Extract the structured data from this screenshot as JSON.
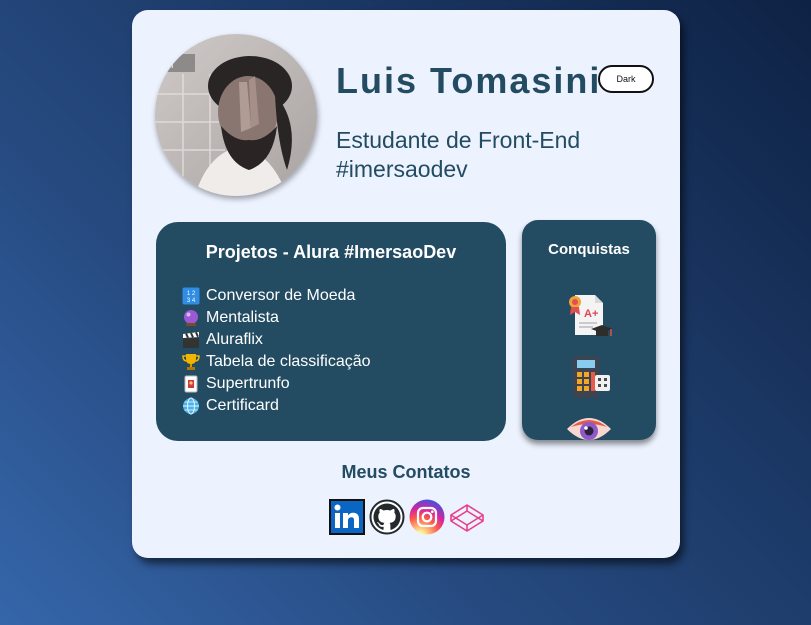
{
  "profile": {
    "name": "Luis Tomasini",
    "subtitle_line1": "Estudante de Front-End",
    "subtitle_line2": "#imersaodev",
    "photo_alt": "Foto de perfil"
  },
  "theme_toggle": {
    "label": "Dark"
  },
  "projects": {
    "title": "Projetos - Alura #ImersaoDev",
    "items": [
      {
        "icon": "numbers-icon",
        "label": "Conversor de Moeda"
      },
      {
        "icon": "crystal-ball-icon",
        "label": "Mentalista"
      },
      {
        "icon": "clapper-board-icon",
        "label": "Aluraflix"
      },
      {
        "icon": "trophy-icon",
        "label": "Tabela de classificação"
      },
      {
        "icon": "playing-card-icon",
        "label": "Supertrunfo"
      },
      {
        "icon": "globe-icon",
        "label": "Certificard"
      }
    ]
  },
  "achievements": {
    "title": "Conquistas",
    "icons": [
      "certificate-icon",
      "calculator-icon",
      "eye-icon"
    ]
  },
  "contacts": {
    "title": "Meus Contatos",
    "links": [
      {
        "icon": "linkedin-icon",
        "color": "#0a66c2"
      },
      {
        "icon": "github-icon",
        "color": "#24292e"
      },
      {
        "icon": "instagram-icon",
        "color": "#d6249f"
      },
      {
        "icon": "codepen-icon",
        "color": "#e83e8c"
      }
    ]
  },
  "colors": {
    "primary": "#234c62",
    "card": "#ecf2fe",
    "background_start": "#3566aa",
    "background_end": "#0e2244"
  }
}
